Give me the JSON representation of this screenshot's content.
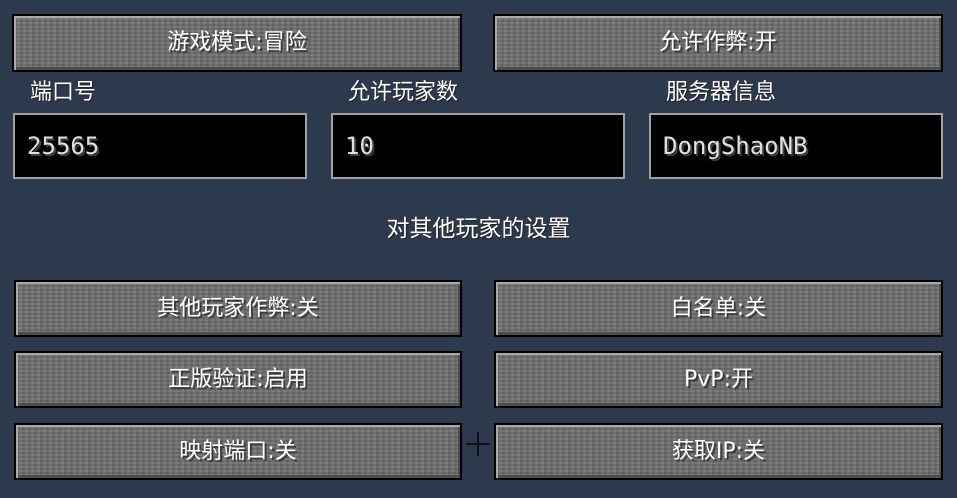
{
  "top_buttons": {
    "game_mode": "游戏模式:冒险",
    "allow_cheats": "允许作弊:开"
  },
  "fields": {
    "port": {
      "label": "端口号",
      "value": "25565"
    },
    "max_players": {
      "label": "允许玩家数",
      "value": "10"
    },
    "server_info": {
      "label": "服务器信息",
      "value": "DongShaoNB"
    }
  },
  "section": {
    "title": "对其他玩家的设置"
  },
  "player_buttons": {
    "other_players_cheats": "其他玩家作弊:关",
    "whitelist": "白名单:关",
    "online_mode": "正版验证:启用",
    "pvp": "PvP:开",
    "port_mapping": "映射端口:关",
    "get_ip": "获取IP:关"
  },
  "colors": {
    "background": "#2d3a4d",
    "button": "#6f6f6f",
    "input_bg": "#000000",
    "input_border": "#a0a0a0",
    "text": "#ffffff"
  },
  "icons": {
    "crosshair": "crosshair-icon"
  }
}
